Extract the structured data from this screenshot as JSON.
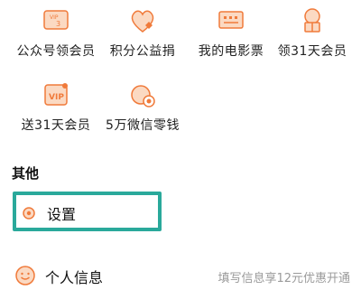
{
  "colors": {
    "accent": "#f07a3a",
    "accent_light": "#fbd9c2",
    "highlight_border": "#2aa99b",
    "hint_text": "#9a9a9a"
  },
  "grid": {
    "row1": [
      {
        "label": "公众号领会员",
        "icon": "vip-card-icon",
        "icon_text": "3"
      },
      {
        "label": "积分公益捐",
        "icon": "heart-charity-icon"
      },
      {
        "label": "我的电影票",
        "icon": "movie-ticket-icon"
      },
      {
        "label": "领31天会员",
        "icon": "gift-tree-icon"
      }
    ],
    "row2": [
      {
        "label": "送31天会员",
        "icon": "vip-gift-card-icon",
        "icon_text": "VIP"
      },
      {
        "label": "5万微信零钱",
        "icon": "coin-bag-icon"
      }
    ]
  },
  "section": {
    "title": "其他"
  },
  "settings": {
    "label": "设置",
    "icon": "gear-icon"
  },
  "profile": {
    "label": "个人信息",
    "icon": "smiley-chat-icon",
    "hint": "填写信息享12元优惠开通"
  }
}
